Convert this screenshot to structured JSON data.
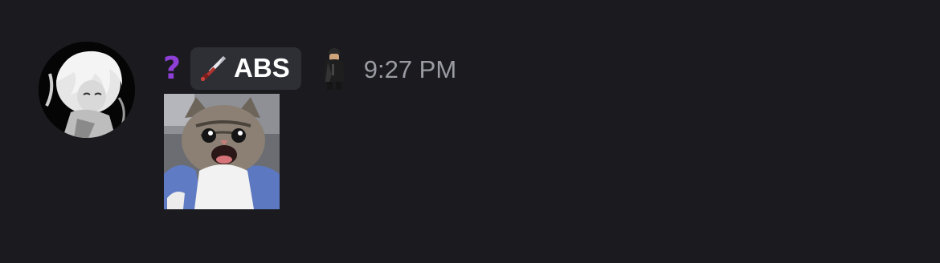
{
  "message": {
    "author": {
      "name": "?",
      "name_color": "#8d3fd6",
      "avatar_icon": "anime-girl-avatar"
    },
    "tag": {
      "icon": "sword-icon",
      "label": "ABS"
    },
    "decoration_icon": "soldier-figure-icon",
    "timestamp": "9:27 PM",
    "attachment": {
      "type": "image",
      "subject": "cat-meme-image"
    }
  },
  "colors": {
    "background": "#1a1a1f",
    "tag_background": "#2e2f35",
    "timestamp": "#9a9ba3"
  }
}
